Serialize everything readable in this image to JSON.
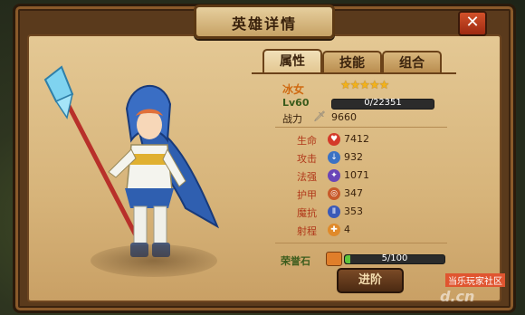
{
  "window": {
    "title": "英雄详情",
    "close_label": "✕"
  },
  "tabs": [
    {
      "label": "属性",
      "active": true
    },
    {
      "label": "技能",
      "active": false
    },
    {
      "label": "组合",
      "active": false
    }
  ],
  "hero": {
    "name": "冰女",
    "stars": "★★★★★",
    "level_label": "Lv60",
    "exp_text": "0/22351",
    "power_label": "战力",
    "power_value": "9660"
  },
  "stats": [
    {
      "label": "生命",
      "value": "7412",
      "icon": "heart-icon",
      "color": "#d43a2a"
    },
    {
      "label": "攻击",
      "value": "932",
      "icon": "sword-down-icon",
      "color": "#3a72c4"
    },
    {
      "label": "法强",
      "value": "1071",
      "icon": "magic-icon",
      "color": "#6a45b8"
    },
    {
      "label": "护甲",
      "value": "347",
      "icon": "shield-icon",
      "color": "#c85a2a"
    },
    {
      "label": "魔抗",
      "value": "353",
      "icon": "magic-resist-icon",
      "color": "#3a5ab8"
    },
    {
      "label": "射程",
      "value": "4",
      "icon": "range-icon",
      "color": "#e08a2a"
    }
  ],
  "honor": {
    "label": "荣誉石",
    "text": "5/100",
    "progress": 0.05
  },
  "advance_button": {
    "label": "进阶"
  },
  "watermark": {
    "site": "当乐玩家社区",
    "domain": "d.cn"
  }
}
